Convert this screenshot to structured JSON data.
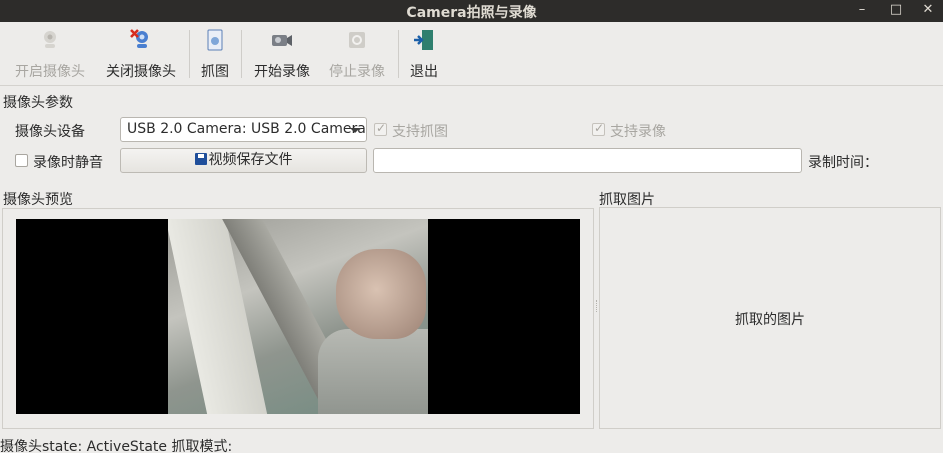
{
  "window": {
    "title": "Camera拍照与录像",
    "min": "–",
    "max": "□",
    "close": "✕"
  },
  "toolbar": {
    "open_camera": "开启摄像头",
    "close_camera": "关闭摄像头",
    "capture": "抓图",
    "start_record": "开始录像",
    "stop_record": "停止录像",
    "exit": "退出"
  },
  "params": {
    "group_title": "摄像头参数",
    "device_label": "摄像头设备",
    "device_value": "USB 2.0 Camera: USB 2.0 Camera",
    "support_capture": "支持抓图",
    "support_record": "支持录像",
    "mute_label": "录像时静音",
    "save_button": "视频保存文件",
    "save_path": "",
    "record_time_label": "录制时间："
  },
  "preview": {
    "title": "摄像头预览"
  },
  "capture": {
    "title": "抓取图片",
    "placeholder": "抓取的图片"
  },
  "status": {
    "text": "摄像头state: ActiveState  抓取模式:"
  }
}
